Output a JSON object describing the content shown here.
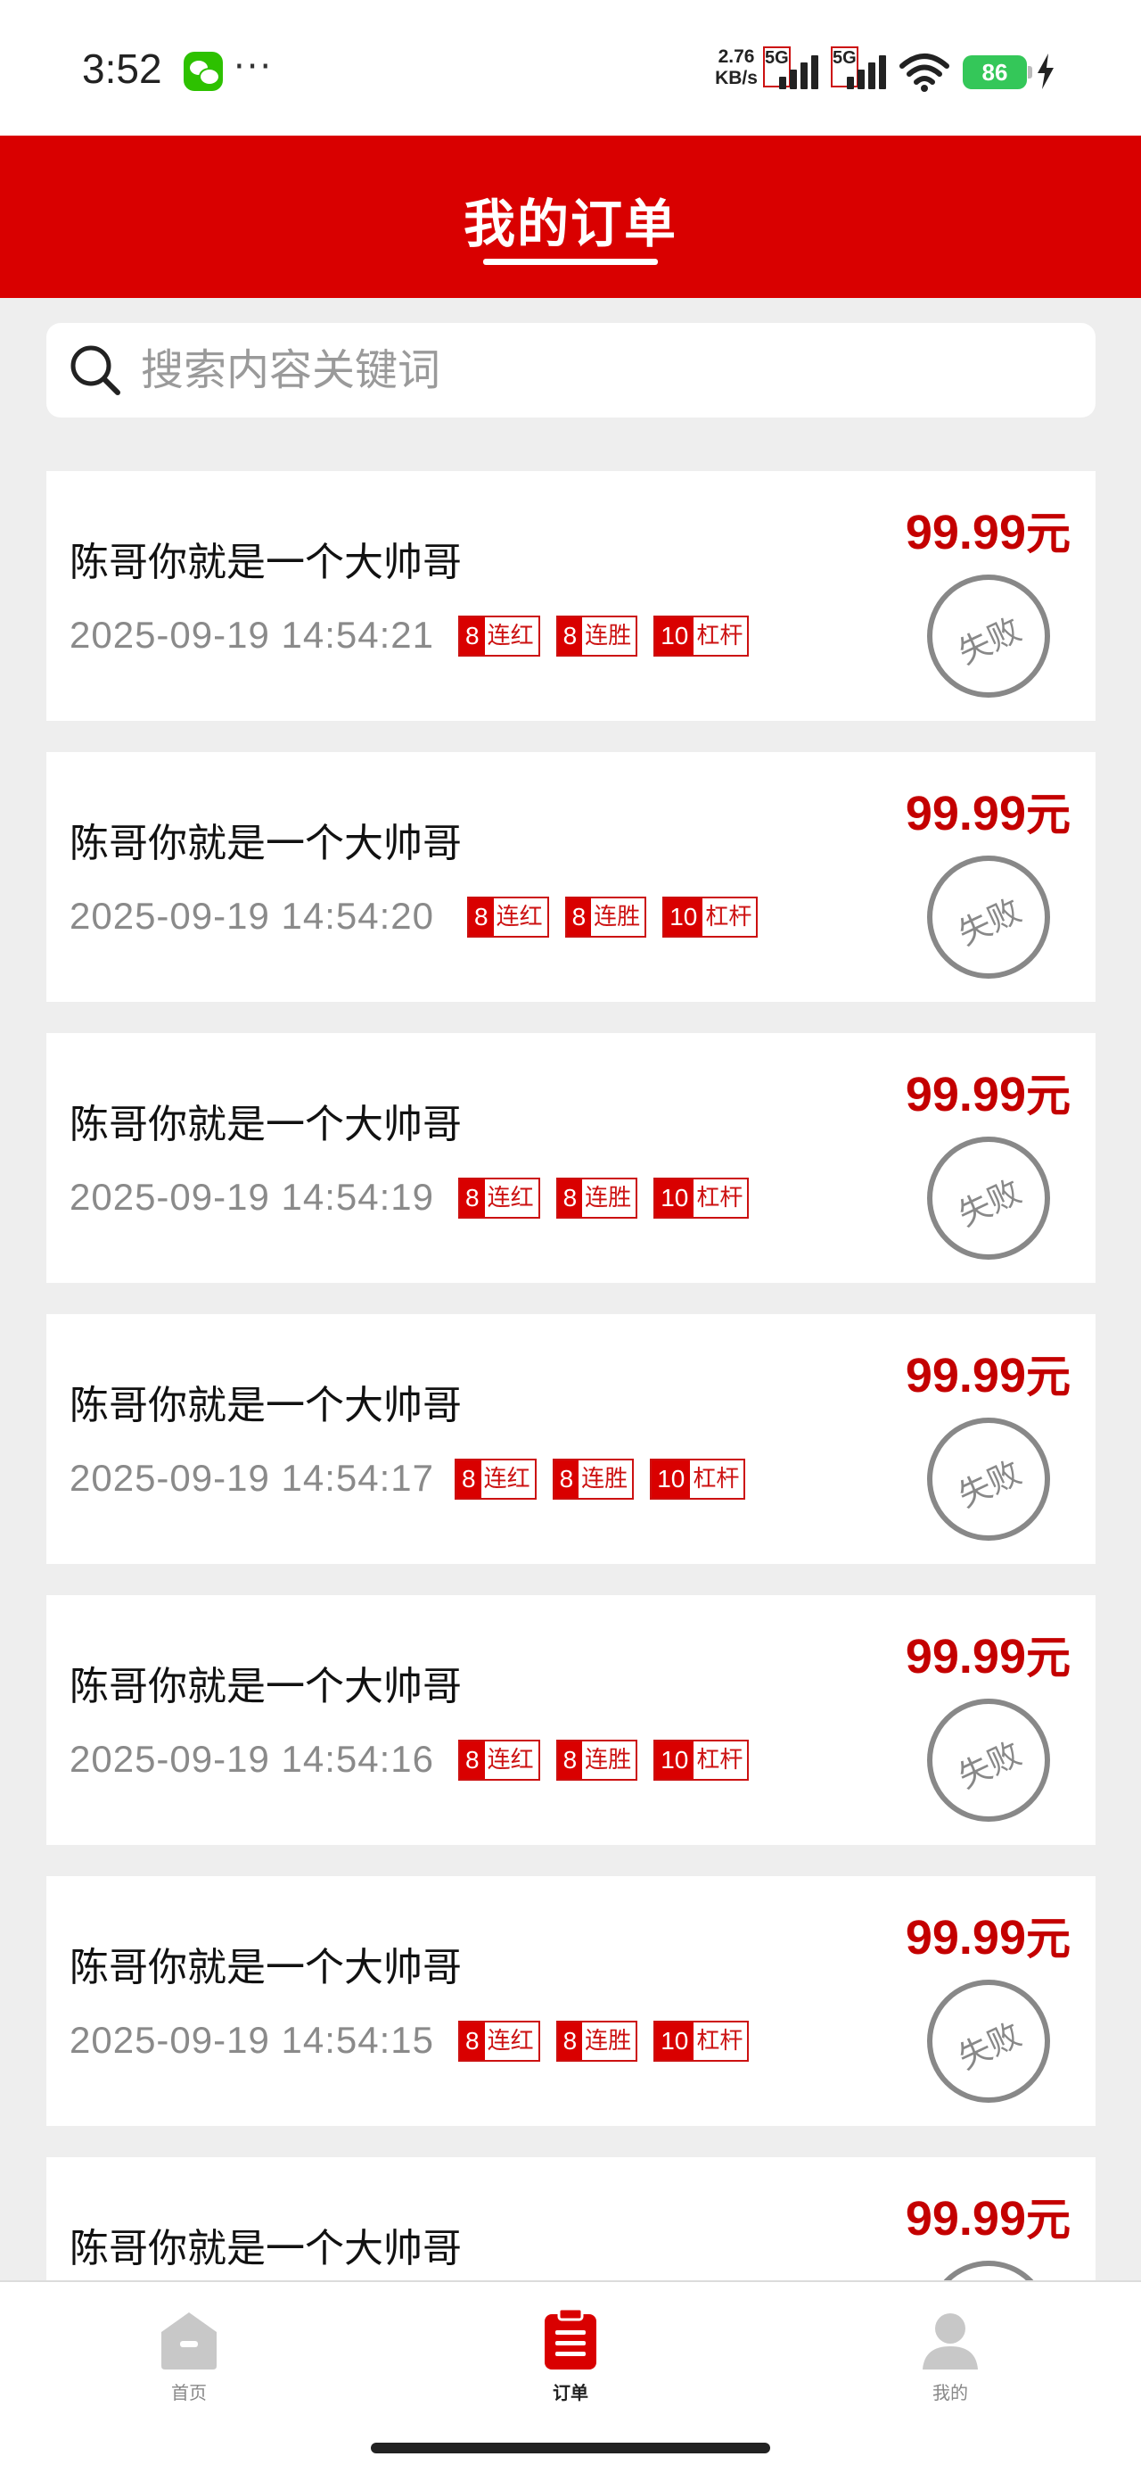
{
  "status_bar": {
    "time": "3:52",
    "more": "···",
    "net_speed_value": "2.76",
    "net_speed_unit": "KB/s",
    "sim1": "5G",
    "sim2": "5G",
    "battery": "86",
    "icons": [
      "wechat-icon",
      "signal-icon",
      "wifi-icon",
      "battery-icon",
      "charging-icon"
    ]
  },
  "header": {
    "title": "我的订单"
  },
  "search": {
    "placeholder": "搜索内容关键词"
  },
  "orders": [
    {
      "title": "陈哥你就是一个大帅哥",
      "time": "2025-09-19 14:54:21",
      "price": "99.99",
      "unit": "元",
      "status": "失败",
      "tags": [
        {
          "num": "8",
          "label": "连红"
        },
        {
          "num": "8",
          "label": "连胜"
        },
        {
          "num": "10",
          "label": "杠杆"
        }
      ]
    },
    {
      "title": "陈哥你就是一个大帅哥",
      "time": "2025-09-19 14:54:20",
      "price": "99.99",
      "unit": "元",
      "status": "失败",
      "tags": [
        {
          "num": "8",
          "label": "连红"
        },
        {
          "num": "8",
          "label": "连胜"
        },
        {
          "num": "10",
          "label": "杠杆"
        }
      ]
    },
    {
      "title": "陈哥你就是一个大帅哥",
      "time": "2025-09-19 14:54:19",
      "price": "99.99",
      "unit": "元",
      "status": "失败",
      "tags": [
        {
          "num": "8",
          "label": "连红"
        },
        {
          "num": "8",
          "label": "连胜"
        },
        {
          "num": "10",
          "label": "杠杆"
        }
      ]
    },
    {
      "title": "陈哥你就是一个大帅哥",
      "time": "2025-09-19 14:54:17",
      "price": "99.99",
      "unit": "元",
      "status": "失败",
      "tags": [
        {
          "num": "8",
          "label": "连红"
        },
        {
          "num": "8",
          "label": "连胜"
        },
        {
          "num": "10",
          "label": "杠杆"
        }
      ]
    },
    {
      "title": "陈哥你就是一个大帅哥",
      "time": "2025-09-19 14:54:16",
      "price": "99.99",
      "unit": "元",
      "status": "失败",
      "tags": [
        {
          "num": "8",
          "label": "连红"
        },
        {
          "num": "8",
          "label": "连胜"
        },
        {
          "num": "10",
          "label": "杠杆"
        }
      ]
    },
    {
      "title": "陈哥你就是一个大帅哥",
      "time": "2025-09-19 14:54:15",
      "price": "99.99",
      "unit": "元",
      "status": "失败",
      "tags": [
        {
          "num": "8",
          "label": "连红"
        },
        {
          "num": "8",
          "label": "连胜"
        },
        {
          "num": "10",
          "label": "杠杆"
        }
      ]
    },
    {
      "title": "陈哥你就是一个大帅哥",
      "price": "99.99",
      "unit": "元"
    }
  ],
  "bottom_nav": {
    "items": [
      {
        "label": "首页",
        "icon": "home-icon",
        "active": false
      },
      {
        "label": "订单",
        "icon": "order-icon",
        "active": true
      },
      {
        "label": "我的",
        "icon": "profile-icon",
        "active": false
      }
    ]
  },
  "colors": {
    "brand_red": "#d90000",
    "price_red": "#c40000",
    "status_gray": "#888888",
    "background": "#eeeeee"
  }
}
